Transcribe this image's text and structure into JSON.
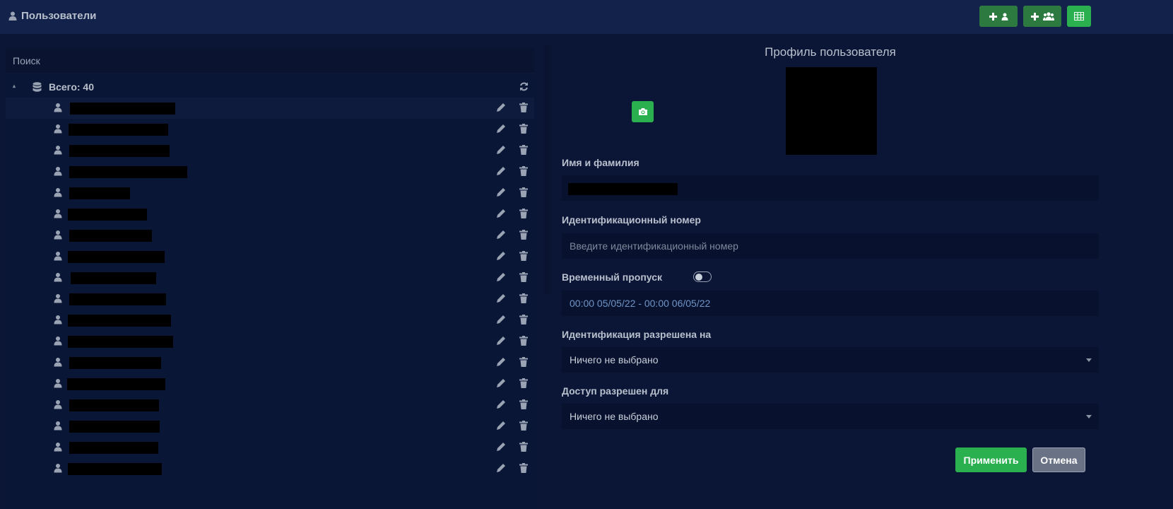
{
  "header": {
    "title": "Пользователи",
    "icons": [
      "user-icon",
      "add-user-icon",
      "add-group-icon",
      "table-icon"
    ]
  },
  "search": {
    "placeholder": "Поиск"
  },
  "tree": {
    "total_label": "Всего: 40"
  },
  "users": [
    {
      "name_redacted": true
    },
    {
      "name_redacted": true
    },
    {
      "name_redacted": true
    },
    {
      "name_redacted": true
    },
    {
      "name_redacted": true
    },
    {
      "name_redacted": true
    },
    {
      "name_redacted": true
    },
    {
      "name_redacted": true
    },
    {
      "name_redacted": true
    },
    {
      "name_redacted": true
    },
    {
      "name_redacted": true
    },
    {
      "name_redacted": true
    },
    {
      "name_redacted": true
    },
    {
      "name_redacted": true
    },
    {
      "name_redacted": true
    },
    {
      "name_redacted": true
    },
    {
      "name_redacted": true
    },
    {
      "name_redacted": true
    }
  ],
  "profile": {
    "title": "Профиль пользователя",
    "name_label": "Имя и фамилия",
    "id_label": "Идентификационный номер",
    "id_placeholder": "Введите идентификационный номер",
    "temp_pass_label": "Временный пропуск",
    "temp_pass_enabled": false,
    "date_range": "00:00 05/05/22 - 00:00 06/05/22",
    "ident_label": "Идентификация разрешена на",
    "ident_value": "Ничего не выбрано",
    "access_label": "Доступ разрешен для",
    "access_value": "Ничего не выбрано",
    "apply_label": "Применить",
    "cancel_label": "Отмена"
  },
  "colors": {
    "background": "#0b1637",
    "accent_green": "#2bb050",
    "dark_green": "#2d7a41"
  }
}
